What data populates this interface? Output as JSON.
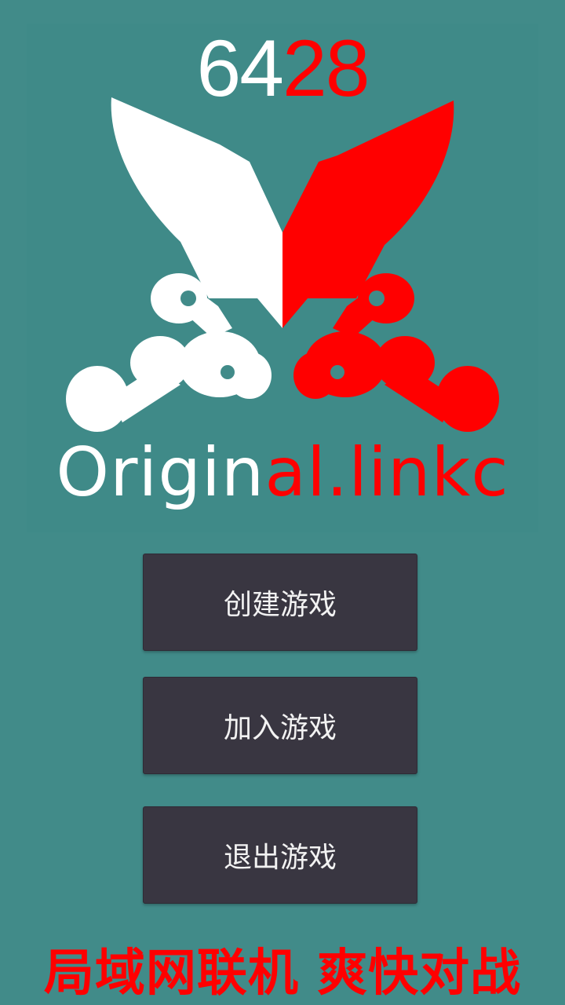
{
  "logo": {
    "number_white": "64",
    "number_red": "28",
    "word_white": "Origin",
    "word_red": "al.linkc",
    "icon": "crossed-swords-icon",
    "colors": {
      "white": "#ffffff",
      "red": "#ff0000",
      "background": "#418b89"
    }
  },
  "menu": {
    "create_label": "创建游戏",
    "join_label": "加入游戏",
    "exit_label": "退出游戏",
    "button_color": "#393641"
  },
  "slogan": "局域网联机  爽快对战"
}
